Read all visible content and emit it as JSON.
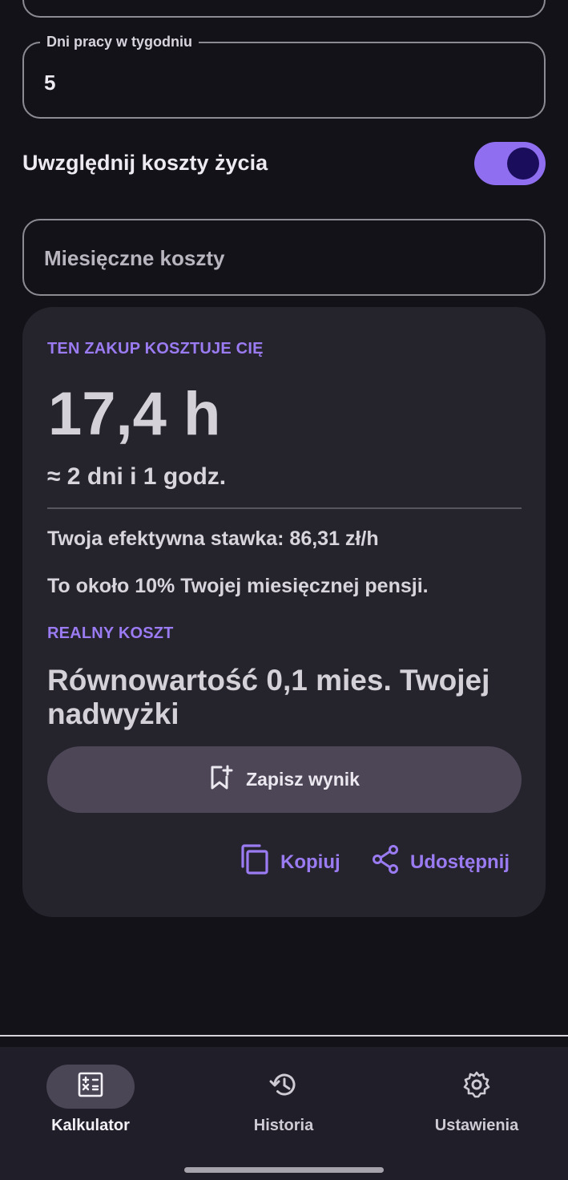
{
  "form": {
    "days_label": "Dni pracy w tygodniu",
    "days_value": "5",
    "toggle_label": "Uwzględnij koszty życia",
    "toggle_on": true,
    "costs_placeholder": "Miesięczne koszty"
  },
  "result": {
    "eyebrow": "TEN ZAKUP KOSZTUJE CIĘ",
    "hours": "17,4 h",
    "approx": "≈ 2 dni i 1 godz.",
    "rate": "Twoja efektywna stawka: 86,31 zł/h",
    "salary_share": "To około 10% Twojej miesięcznej pensji.",
    "real_cost_eyebrow": "REALNY KOSZT",
    "real_cost": "Równowartość 0,1 mies. Twojej nadwyżki",
    "save_label": "Zapisz wynik",
    "copy_label": "Kopiuj",
    "share_label": "Udostępnij"
  },
  "nav": {
    "calculator": "Kalkulator",
    "history": "Historia",
    "settings": "Ustawienia",
    "active": "calculator"
  },
  "colors": {
    "accent": "#9b7bf2",
    "background": "#121218",
    "card": "#25242d"
  }
}
